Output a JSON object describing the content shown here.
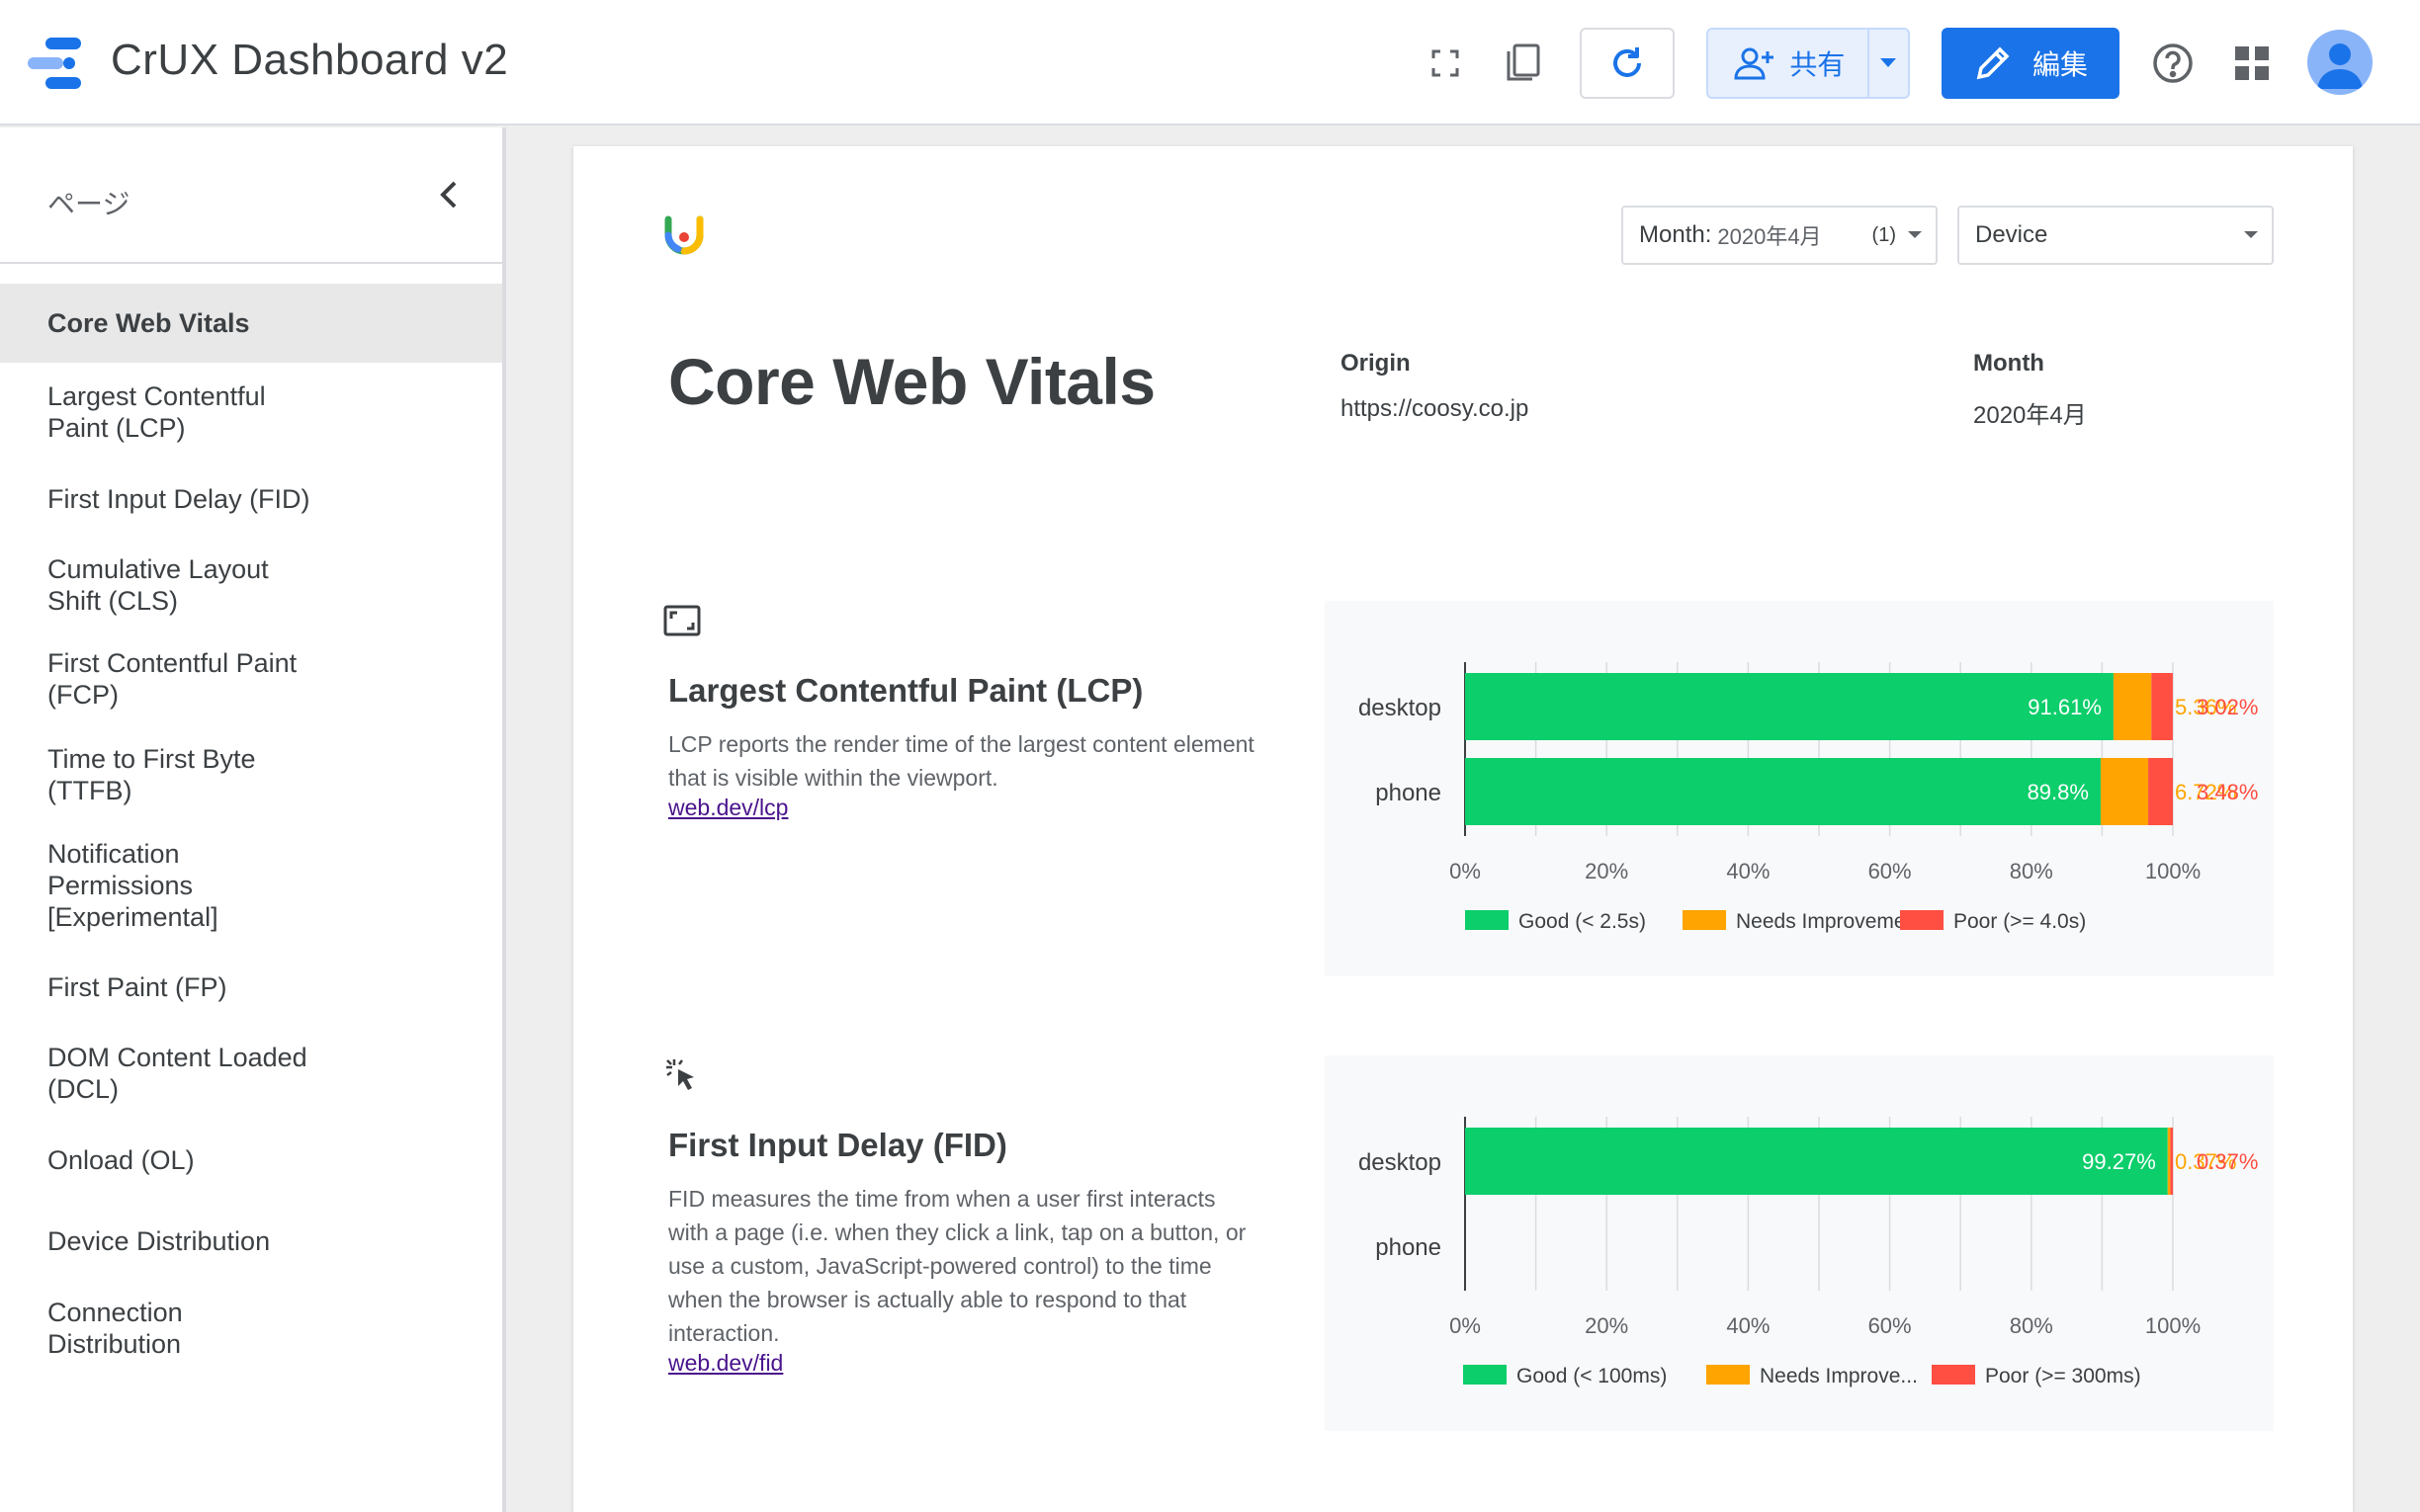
{
  "app": {
    "title": "CrUX Dashboard v2"
  },
  "toolbar": {
    "share_label": "共有",
    "edit_label": "編集"
  },
  "sidebar": {
    "title": "ページ",
    "items": [
      {
        "label": "Core Web Vitals",
        "active": true
      },
      {
        "label": "Largest Contentful Paint (LCP)"
      },
      {
        "label": "First Input Delay (FID)"
      },
      {
        "label": "Cumulative Layout Shift (CLS)"
      },
      {
        "label": "First Contentful Paint (FCP)"
      },
      {
        "label": "Time to First Byte (TTFB)"
      },
      {
        "label": "Notification Permissions [Experimental]"
      },
      {
        "label": "First Paint (FP)"
      },
      {
        "label": "DOM Content Loaded (DCL)"
      },
      {
        "label": "Onload (OL)"
      },
      {
        "label": "Device Distribution"
      },
      {
        "label": "Connection Distribution"
      }
    ]
  },
  "filters": {
    "month": {
      "label": "Month:",
      "value": "2020年4月",
      "count": "(1)"
    },
    "device": {
      "value": "Device"
    }
  },
  "report": {
    "title": "Core Web Vitals",
    "origin_label": "Origin",
    "origin_value": "https://coosy.co.jp",
    "month_label": "Month",
    "month_value": "2020年4月"
  },
  "lcp": {
    "title": "Largest Contentful Paint (LCP)",
    "description": "LCP reports the render time of the largest content element that is visible within the viewport.",
    "link": "web.dev/lcp"
  },
  "fid": {
    "title": "First Input Delay (FID)",
    "description": "FID measures the time from when a user first interacts with a page (i.e. when they click a link, tap on a button, or use a custom, JavaScript-powered control) to the time when the browser is actually able to respond to that interaction.",
    "link": "web.dev/fid"
  },
  "colors": {
    "good": "#0cce6b",
    "needs": "#ffa400",
    "poor": "#ff4e42",
    "accent": "#1a73e8"
  },
  "chart_data": [
    {
      "type": "bar",
      "orientation": "horizontal",
      "stacked": true,
      "categories": [
        "desktop",
        "phone"
      ],
      "series": [
        {
          "name": "Good (< 2.5s)",
          "values": [
            91.61,
            89.8
          ]
        },
        {
          "name": "Needs Improvement",
          "values": [
            5.36,
            6.72
          ]
        },
        {
          "name": "Poor (>= 4.0s)",
          "values": [
            3.02,
            3.48
          ]
        }
      ],
      "data_labels": [
        {
          "good": "91.61%",
          "needs": "5.36%",
          "poor": "3.02%"
        },
        {
          "good": "89.8%",
          "needs": "6.72%",
          "poor": "3.48%"
        }
      ],
      "xticks": [
        "0%",
        "20%",
        "40%",
        "60%",
        "80%",
        "100%"
      ],
      "xlim": [
        0,
        100
      ],
      "grid": true,
      "legend": "bottom"
    },
    {
      "type": "bar",
      "orientation": "horizontal",
      "stacked": true,
      "categories": [
        "desktop",
        "phone"
      ],
      "series": [
        {
          "name": "Good (< 100ms)",
          "values": [
            99.27,
            0
          ]
        },
        {
          "name": "Needs Improve...",
          "values": [
            0.37,
            0
          ]
        },
        {
          "name": "Poor (>= 300ms)",
          "values": [
            0.37,
            0
          ]
        }
      ],
      "data_labels": [
        {
          "good": "99.27%",
          "needs": "0.37%",
          "poor": "0.37%"
        },
        {
          "good": "",
          "needs": "",
          "poor": ""
        }
      ],
      "xticks": [
        "0%",
        "20%",
        "40%",
        "60%",
        "80%",
        "100%"
      ],
      "xlim": [
        0,
        100
      ],
      "grid": true,
      "legend": "bottom"
    }
  ]
}
